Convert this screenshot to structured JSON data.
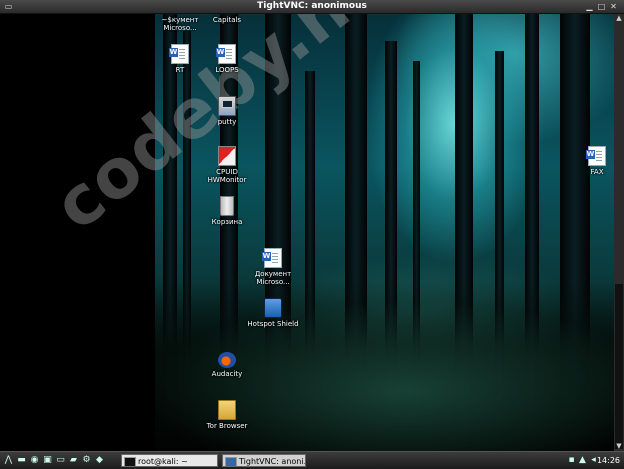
{
  "window": {
    "title": "TightVNC: anonimous",
    "buttons": {
      "minimize": "▁",
      "maximize": "□",
      "close": "✕"
    }
  },
  "desktop": {
    "watermark": "codeby.net",
    "icons": [
      {
        "id": "doc-tilde",
        "label": "~$кумент Microso...",
        "icon": "document-icon"
      },
      {
        "id": "capitals",
        "label": "Capitals",
        "icon": "folder-icon"
      },
      {
        "id": "rt",
        "label": "RT",
        "icon": "document-icon"
      },
      {
        "id": "loops",
        "label": "LOOPS",
        "icon": "document-icon"
      },
      {
        "id": "putty",
        "label": "putty",
        "icon": "putty-icon"
      },
      {
        "id": "cpuid",
        "label": "CPUID HWMonitor",
        "icon": "cpuid-icon"
      },
      {
        "id": "korzina",
        "label": "Корзина",
        "icon": "trash-icon"
      },
      {
        "id": "doc-microsoft",
        "label": "Документ Microso...",
        "icon": "document-icon"
      },
      {
        "id": "hotspot",
        "label": "Hotspot Shield",
        "icon": "hotspot-shield-icon"
      },
      {
        "id": "audacity",
        "label": "Audacity",
        "icon": "audacity-icon"
      },
      {
        "id": "tor",
        "label": "Tor Browser",
        "icon": "tor-browser-icon"
      },
      {
        "id": "fax",
        "label": "FAX",
        "icon": "document-icon"
      }
    ]
  },
  "taskbar": {
    "launchers": [
      "menu-icon",
      "file-manager-icon",
      "browser-icon",
      "terminal-icon",
      "monitor-icon",
      "folder-icon",
      "settings-icon",
      "app-icon"
    ],
    "tasks": [
      {
        "label": "root@kali: ~",
        "icon": "terminal-icon"
      },
      {
        "label": "TightVNC: anoni...",
        "icon": "vnc-icon"
      }
    ],
    "clock": "14:26"
  }
}
